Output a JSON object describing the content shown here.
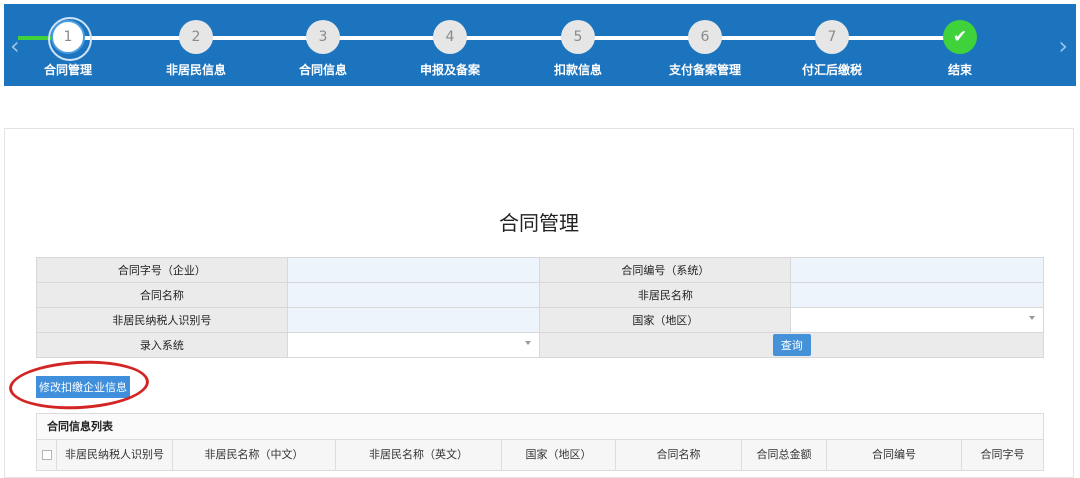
{
  "steps": [
    {
      "num": "1",
      "label": "合同管理",
      "state": "current"
    },
    {
      "num": "2",
      "label": "非居民信息",
      "state": "pending"
    },
    {
      "num": "3",
      "label": "合同信息",
      "state": "pending"
    },
    {
      "num": "4",
      "label": "申报及备案",
      "state": "pending"
    },
    {
      "num": "5",
      "label": "扣款信息",
      "state": "pending"
    },
    {
      "num": "6",
      "label": "支付备案管理",
      "state": "pending"
    },
    {
      "num": "7",
      "label": "付汇后缴税",
      "state": "pending"
    },
    {
      "num": "✔",
      "label": "结束",
      "state": "finish"
    }
  ],
  "nav": {
    "prev": "‹",
    "next": "›"
  },
  "page_title": "合同管理",
  "query": {
    "contract_char_label": "合同字号（企业）",
    "contract_no_label": "合同编号（系统）",
    "contract_name_label": "合同名称",
    "nonresident_name_label": "非居民名称",
    "taxpayer_id_label": "非居民纳税人识别号",
    "country_label": "国家（地区）",
    "entry_system_label": "录入系统",
    "search_button": "查询"
  },
  "edit_button": "修改扣缴企业信息",
  "list": {
    "title": "合同信息列表",
    "columns": [
      "非居民纳税人识别号",
      "非居民名称（中文）",
      "非居民名称（英文）",
      "国家（地区）",
      "合同名称",
      "合同总金额",
      "合同编号",
      "合同字号"
    ]
  },
  "colors": {
    "stepbar": "#1c73be",
    "done": "#3fd23a",
    "button": "#4592d9",
    "highlight": "#d42525"
  }
}
